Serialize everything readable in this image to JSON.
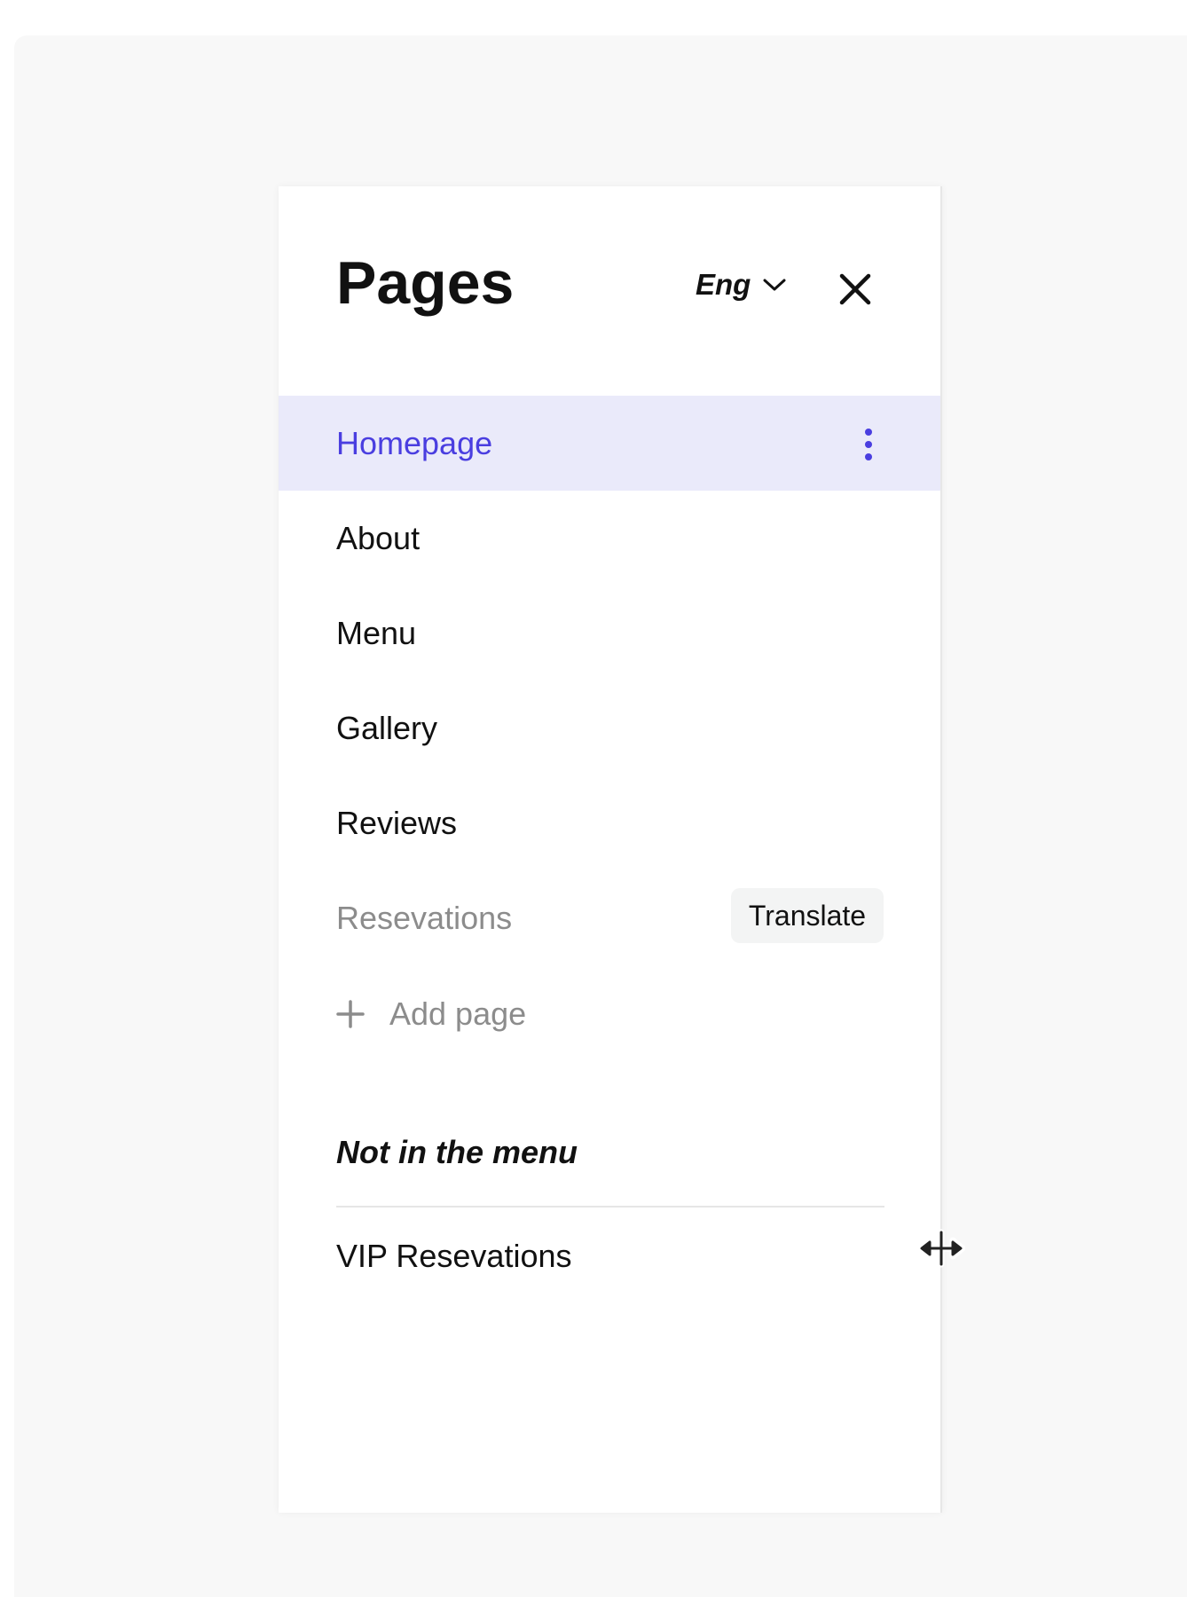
{
  "panel": {
    "title": "Pages",
    "language": {
      "label": "Eng",
      "icon": "chevron-down-icon"
    },
    "close_icon": "close-icon"
  },
  "pages": [
    {
      "label": "Homepage",
      "state": "active",
      "menu_icon": "kebab-icon"
    },
    {
      "label": "About",
      "state": "normal"
    },
    {
      "label": "Menu",
      "state": "normal"
    },
    {
      "label": "Gallery",
      "state": "normal"
    },
    {
      "label": "Reviews",
      "state": "normal"
    },
    {
      "label": "Resevations",
      "state": "untranslated",
      "action_label": "Translate"
    }
  ],
  "add_page": {
    "label": "Add page",
    "icon": "plus-icon"
  },
  "hidden_section": {
    "heading": "Not in the menu",
    "items": [
      {
        "label": "VIP Resevations"
      }
    ]
  },
  "colors": {
    "accent": "#4a3ee0",
    "active_bg": "#eaeafa",
    "muted_text": "#8c8c8c",
    "button_bg": "#f3f4f4"
  },
  "pointer": {
    "icon": "resize-horizontal-cursor-icon"
  }
}
